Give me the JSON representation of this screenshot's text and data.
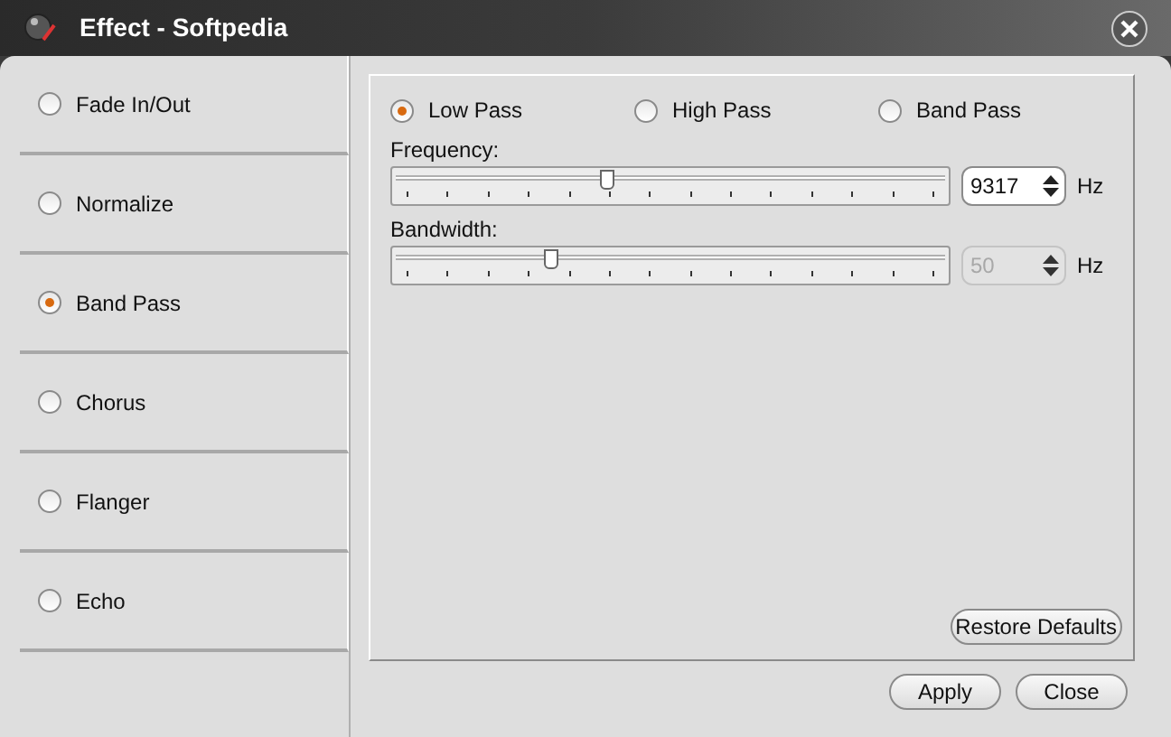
{
  "window": {
    "title": "Effect - Softpedia"
  },
  "effects": [
    {
      "label": "Fade In/Out",
      "selected": false
    },
    {
      "label": "Normalize",
      "selected": false
    },
    {
      "label": "Band Pass",
      "selected": true
    },
    {
      "label": "Chorus",
      "selected": false
    },
    {
      "label": "Flanger",
      "selected": false
    },
    {
      "label": "Echo",
      "selected": false
    }
  ],
  "filter_types": [
    {
      "label": "Low Pass",
      "selected": true
    },
    {
      "label": "High Pass",
      "selected": false
    },
    {
      "label": "Band Pass",
      "selected": false
    }
  ],
  "sliders": [
    {
      "label": "Frequency:",
      "level": 0.385,
      "value": "9317",
      "unit": "Hz",
      "disabled": false
    },
    {
      "label": "Bandwidth:",
      "level": 0.285,
      "value": "50",
      "unit": "Hz",
      "disabled": true
    }
  ],
  "restore_button": "Restore Defaults",
  "buttons": [
    "Apply",
    "Close"
  ]
}
